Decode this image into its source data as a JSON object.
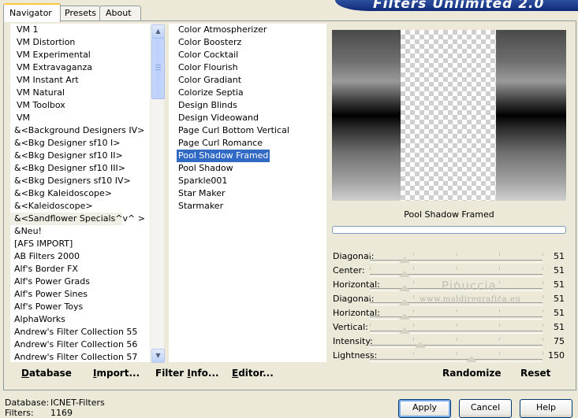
{
  "tabs": [
    "Navigator",
    "Presets",
    "About"
  ],
  "banner_title": "Filters Unlimited 2.0",
  "categories": [
    "VM 1",
    "VM Distortion",
    "VM Experimental",
    "VM Extravaganza",
    "VM Instant Art",
    "VM Natural",
    "VM Toolbox",
    "VM",
    "&<Background Designers IV>",
    "&<Bkg Designer sf10 I>",
    "&<Bkg Designer sf10 II>",
    "&<Bkg Designer sf10 III>",
    "&<Bkg Designers sf10 IV>",
    "&<Bkg Kaleidoscope>",
    "&<Kaleidoscope>",
    "&<Sandflower Specials^v^ >",
    "&Neu!",
    "[AFS IMPORT]",
    "AB Filters 2000",
    "Alf's Border FX",
    "Alf's Power Grads",
    "Alf's Power Sines",
    "Alf's Power Toys",
    "AlphaWorks",
    "Andrew's Filter Collection 55",
    "Andrew's Filter Collection 56",
    "Andrew's Filter Collection 57"
  ],
  "highlighted_category": 15,
  "filters": [
    "Color Atmospherizer",
    "Color Boosterz",
    "Color Cocktail",
    "Color Flourish",
    "Color Gradiant",
    "Colorize Septia",
    "Design Blinds",
    "Design Videowand",
    "Page Curl Bottom Vertical",
    "Page Curl Romance",
    "Pool Shadow Framed",
    "Pool Shadow",
    "Sparkle001",
    "Star Maker",
    "Starmaker"
  ],
  "selected_filter": 10,
  "current_filter_name": "Pool Shadow Framed",
  "sliders": [
    {
      "label": "Diagonal:",
      "value": "51",
      "pos": 0.2
    },
    {
      "label": "Center:",
      "value": "51",
      "pos": 0.2
    },
    {
      "label": "Horizontal:",
      "value": "51",
      "pos": 0.2
    },
    {
      "label": "Diagonal:",
      "value": "51",
      "pos": 0.2
    },
    {
      "label": "Horizontal:",
      "value": "51",
      "pos": 0.2
    },
    {
      "label": "Vertical:",
      "value": "51",
      "pos": 0.2
    },
    {
      "label": "Intensity:",
      "value": "75",
      "pos": 0.294
    },
    {
      "label": "Lightness:",
      "value": "150",
      "pos": 0.588
    }
  ],
  "watermark": {
    "line1": "Pinuccia",
    "line2": "www.maidiregrafica.eu"
  },
  "toolbar": {
    "database": {
      "u": "D",
      "rest": "atabase"
    },
    "import": {
      "u": "I",
      "rest": "mport..."
    },
    "filter_info": {
      "pre": "Filter ",
      "u": "I",
      "rest": "nfo..."
    },
    "editor": {
      "u": "E",
      "rest": "ditor..."
    }
  },
  "randomize_label": "Randomize",
  "reset_label": "Reset",
  "status": {
    "database_key": "Database:",
    "database_val": "ICNET-Filters",
    "filters_key": "Filters:",
    "filters_val": "1169"
  },
  "buttons": {
    "apply": "Apply",
    "cancel": "Cancel",
    "help": "Help"
  }
}
